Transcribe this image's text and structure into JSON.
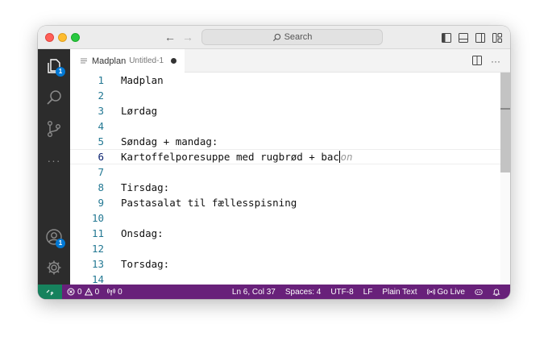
{
  "titlebar": {
    "search_label": "Search",
    "back_icon": "arrow-left-icon",
    "forward_icon": "arrow-right-icon"
  },
  "activity_bar": {
    "explorer_badge": "1",
    "accounts_badge": "1",
    "more_label": "···"
  },
  "tab": {
    "title": "Madplan",
    "description": "Untitled-1"
  },
  "tab_actions": {
    "more_label": "···"
  },
  "editor": {
    "lines": [
      {
        "number": "1",
        "text": "Madplan"
      },
      {
        "number": "2",
        "text": ""
      },
      {
        "number": "3",
        "text": "Lørdag"
      },
      {
        "number": "4",
        "text": ""
      },
      {
        "number": "5",
        "text": "Søndag + mandag:"
      },
      {
        "number": "6",
        "text": "Kartoffelporesuppe med rugbrød + bac",
        "ghost": "on"
      },
      {
        "number": "7",
        "text": ""
      },
      {
        "number": "8",
        "text": "Tirsdag:"
      },
      {
        "number": "9",
        "text": "Pastasalat til fællesspisning"
      },
      {
        "number": "10",
        "text": ""
      },
      {
        "number": "11",
        "text": "Onsdag:"
      },
      {
        "number": "12",
        "text": ""
      },
      {
        "number": "13",
        "text": "Torsdag:"
      },
      {
        "number": "14",
        "text": ""
      }
    ]
  },
  "statusbar": {
    "errors": "0",
    "warnings": "0",
    "ports": "0",
    "position": "Ln 6, Col 37",
    "indent": "Spaces: 4",
    "encoding": "UTF-8",
    "eol": "LF",
    "language": "Plain Text",
    "go_live": "Go Live"
  },
  "colors": {
    "statusbar_bg": "#68217a",
    "remote_bg": "#16825d",
    "activitybar_bg": "#2c2c2c",
    "badge_bg": "#0078d4",
    "line_number": "#237893"
  }
}
